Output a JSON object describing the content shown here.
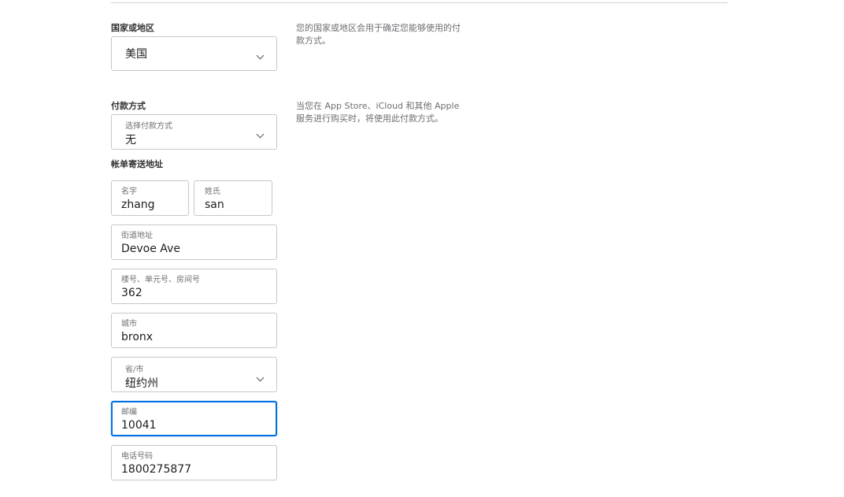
{
  "country": {
    "label": "国家或地区",
    "value": "美国",
    "help": "您的国家或地区会用于确定您能够使用的付款方式。"
  },
  "payment": {
    "label": "付款方式",
    "select_label": "选择付款方式",
    "value": "无",
    "help": "当您在 App Store、iCloud 和其他 Apple 服务进行购买时，将使用此付款方式。"
  },
  "billing": {
    "label": "帐单寄送地址",
    "first_name": {
      "label": "名字",
      "value": "zhang"
    },
    "last_name": {
      "label": "姓氏",
      "value": "san"
    },
    "street": {
      "label": "街道地址",
      "value": " Devoe Ave"
    },
    "unit": {
      "label": "楼号、单元号、房间号",
      "value": "362"
    },
    "city": {
      "label": "城市",
      "value": "bronx"
    },
    "state": {
      "label": "省/市",
      "value": "纽约州"
    },
    "postal": {
      "label": "邮编",
      "value": "10041"
    },
    "phone": {
      "label": "电话号码",
      "value": "1800275877"
    }
  },
  "icons": {
    "dropdown": "chevron-down-icon"
  },
  "colors": {
    "focus": "#0071e3",
    "border": "#c7c7cc",
    "help_text": "#6e6e73"
  }
}
